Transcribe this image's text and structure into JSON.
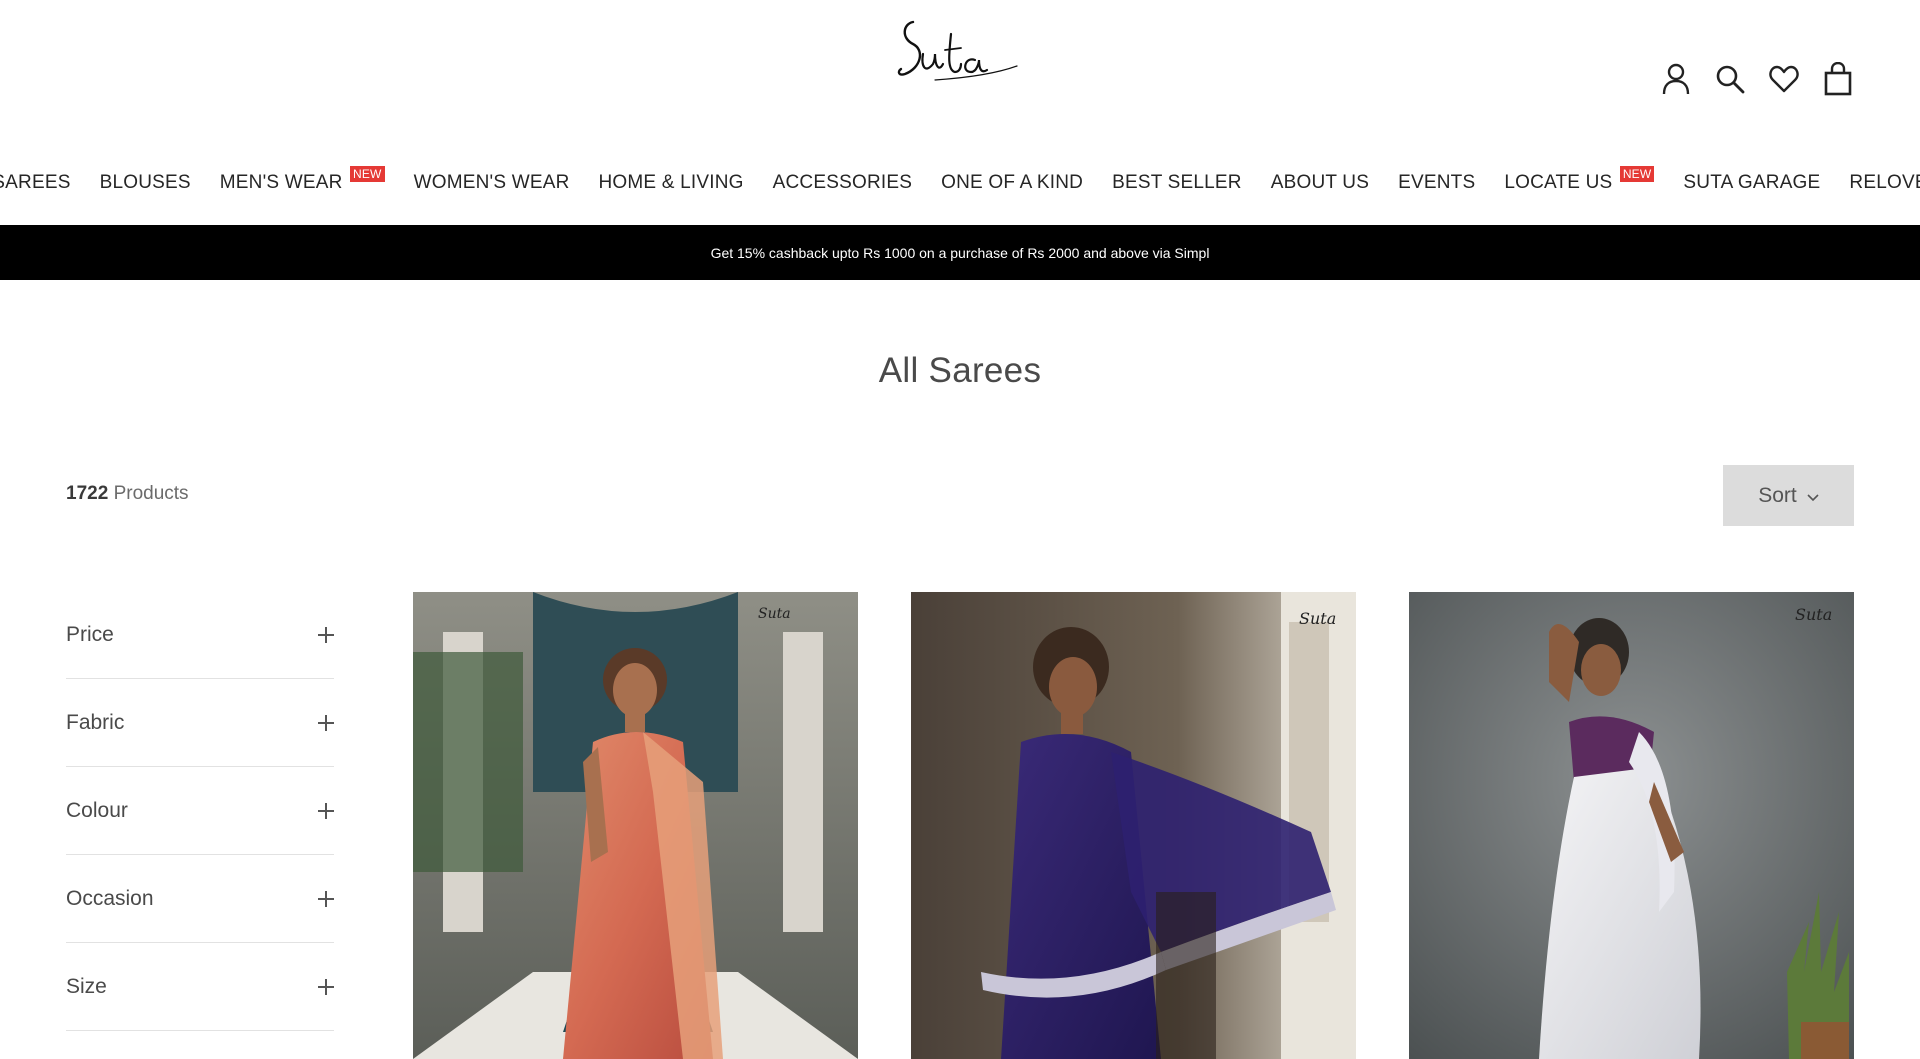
{
  "brand": {
    "logo_text": "Suta"
  },
  "header_icons": [
    "account-icon",
    "search-icon",
    "wishlist-heart-icon",
    "shopping-bag-icon"
  ],
  "nav": [
    {
      "label": "SAREES",
      "badge": ""
    },
    {
      "label": "BLOUSES",
      "badge": ""
    },
    {
      "label": "MEN'S WEAR",
      "badge": "NEW"
    },
    {
      "label": "WOMEN'S WEAR",
      "badge": ""
    },
    {
      "label": "HOME & LIVING",
      "badge": ""
    },
    {
      "label": "ACCESSORIES",
      "badge": ""
    },
    {
      "label": "ONE OF A KIND",
      "badge": ""
    },
    {
      "label": "BEST SELLER",
      "badge": ""
    },
    {
      "label": "ABOUT US",
      "badge": ""
    },
    {
      "label": "EVENTS",
      "badge": ""
    },
    {
      "label": "LOCATE US",
      "badge": "NEW"
    },
    {
      "label": "SUTA GARAGE",
      "badge": ""
    },
    {
      "label": "RELOVE",
      "badge": ""
    }
  ],
  "announcement": "Get 15% cashback upto Rs 1000 on a purchase of Rs 2000 and above via Simpl",
  "collection": {
    "title": "All Sarees",
    "count": "1722",
    "count_suffix": "Products",
    "sort_label": "Sort"
  },
  "filters": [
    {
      "label": "Price"
    },
    {
      "label": "Fabric"
    },
    {
      "label": "Colour"
    },
    {
      "label": "Occasion"
    },
    {
      "label": "Size"
    }
  ],
  "colors": {
    "announcement_bg": "#000000",
    "badge_bg": "#e53935",
    "sort_bg": "#dcdcdc"
  }
}
